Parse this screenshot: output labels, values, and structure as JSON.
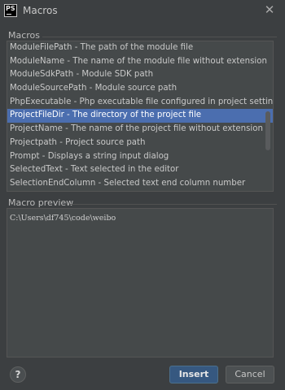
{
  "window": {
    "title": "Macros",
    "app_icon_text": "PS",
    "close_icon": "close-icon"
  },
  "macros": {
    "label": "Macros",
    "items": [
      {
        "label": "ModuleFilePath - The path of the module file",
        "selected": false
      },
      {
        "label": "ModuleName - The name of the module file without extension",
        "selected": false
      },
      {
        "label": "ModuleSdkPath - Module SDK path",
        "selected": false
      },
      {
        "label": "ModuleSourcePath - Module source path",
        "selected": false
      },
      {
        "label": "PhpExecutable - Php executable file configured in project settings",
        "selected": false
      },
      {
        "label": "ProjectFileDir - The directory of the project file",
        "selected": true
      },
      {
        "label": "ProjectName - The name of the project file without extension",
        "selected": false
      },
      {
        "label": "Projectpath - Project source path",
        "selected": false
      },
      {
        "label": "Prompt - Displays a string input dialog",
        "selected": false
      },
      {
        "label": "SelectedText - Text selected in the editor",
        "selected": false
      },
      {
        "label": "SelectionEndColumn - Selected text end column number",
        "selected": false
      }
    ]
  },
  "preview": {
    "label": "Macro preview",
    "value": "C:\\Users\\df745\\code\\weibo"
  },
  "buttons": {
    "help_label": "?",
    "insert_label": "Insert",
    "cancel_label": "Cancel"
  },
  "colors": {
    "background": "#3c3f41",
    "panel": "#45494a",
    "selection": "#4b6eaf",
    "primary_button": "#365880"
  }
}
